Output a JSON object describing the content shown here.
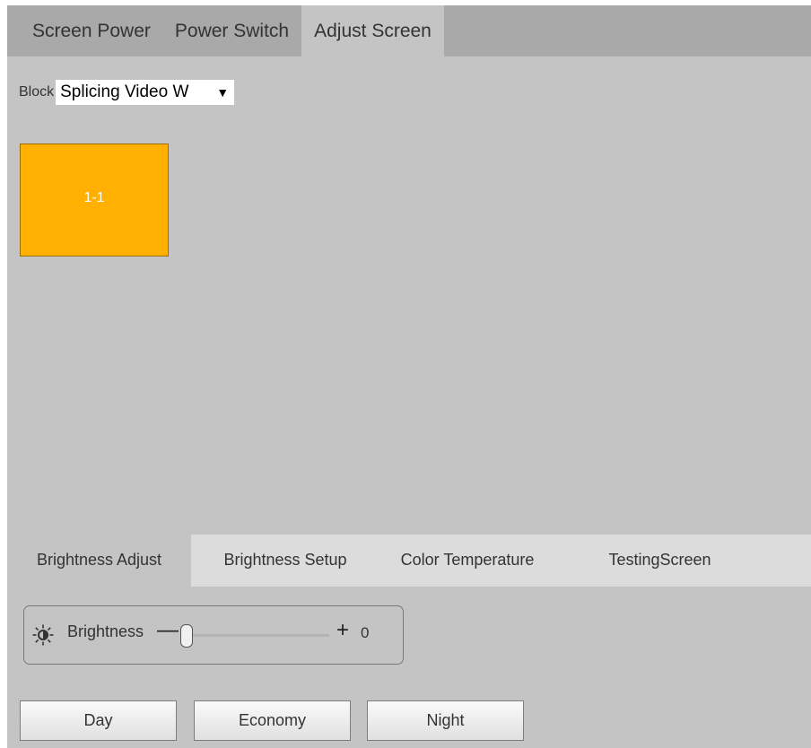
{
  "top_tabs": [
    {
      "label": "Screen Power",
      "active": false
    },
    {
      "label": "Power Switch",
      "active": false
    },
    {
      "label": "Adjust Screen",
      "active": true
    }
  ],
  "block": {
    "label": "Block",
    "selected": "Splicing Video W",
    "arrow": "▼"
  },
  "screen_tile": {
    "label": "1-1",
    "color": "#ffb000"
  },
  "bottom_tabs": [
    {
      "label": "Brightness Adjust",
      "active": true
    },
    {
      "label": "Brightness Setup",
      "active": false
    },
    {
      "label": "Color Temperature",
      "active": false
    },
    {
      "label": "TestingScreen",
      "active": false
    }
  ],
  "brightness": {
    "icon": "sun-icon",
    "label": "Brightness",
    "minus": "—",
    "plus": "+",
    "value": "0"
  },
  "presets": [
    "Day",
    "Economy",
    "Night"
  ],
  "colors": {
    "background": "#c4c4c4",
    "tab_bar": "#a9a9a9",
    "bottom_tab_bar": "#dcdcdc",
    "tile": "#ffb000"
  }
}
